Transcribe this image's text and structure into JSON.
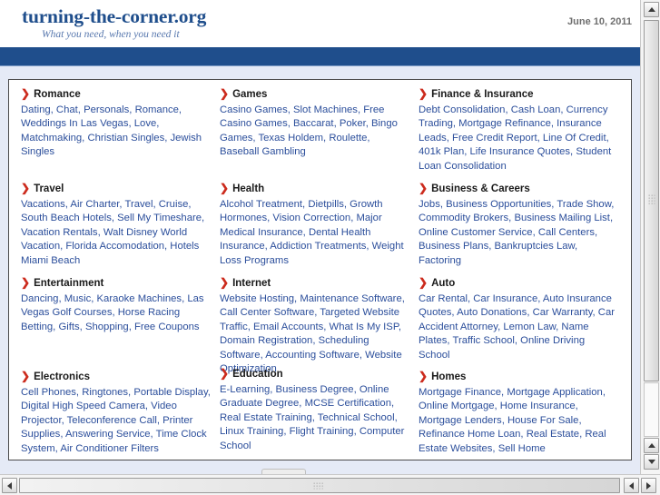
{
  "masthead": {
    "site_title": "turning-the-corner.org",
    "tagline": "What you need, when you need it",
    "date": "June 10, 2011"
  },
  "directory": {
    "arrow_glyph": "❯",
    "columns": [
      {
        "categories": [
          {
            "heading": "Romance",
            "links": "Dating, Chat, Personals, Romance, Weddings In Las Vegas, Love, Matchmaking, Christian Singles, Jewish Singles"
          },
          {
            "heading": "Travel",
            "links": "Vacations, Air Charter, Travel, Cruise, South Beach Hotels, Sell My Timeshare, Vacation Rentals, Walt Disney World Vacation, Florida Accomodation, Hotels Miami Beach"
          },
          {
            "heading": "Entertainment",
            "links": "Dancing, Music, Karaoke Machines, Las Vegas Golf Courses, Horse Racing Betting, Gifts, Shopping, Free Coupons"
          },
          {
            "heading": "Electronics",
            "links": "Cell Phones, Ringtones, Portable Display, Digital High Speed Camera, Video Projector, Teleconference Call, Printer Supplies, Answering Service, Time Clock System, Air Conditioner Filters"
          }
        ]
      },
      {
        "categories": [
          {
            "heading": "Games",
            "links": "Casino Games, Slot Machines, Free Casino Games, Baccarat, Poker, Bingo Games, Texas Holdem, Roulette, Baseball Gambling"
          },
          {
            "heading": "Health",
            "links": "Alcohol Treatment, Dietpills, Growth Hormones, Vision Correction, Major Medical Insurance, Dental Health Insurance, Addiction Treatments, Weight Loss Programs"
          },
          {
            "heading": "Internet",
            "links": "Website Hosting, Maintenance Software, Call Center Software, Targeted Website Traffic, Email Accounts, What Is My ISP, Domain Registration, Scheduling Software, Accounting Software, Website Optimization"
          },
          {
            "heading": "Education",
            "links": "E-Learning, Business Degree, Online Graduate Degree, MCSE Certification, Real Estate Training, Technical School, Linux Training, Flight Training, Computer School"
          }
        ]
      },
      {
        "categories": [
          {
            "heading": "Finance & Insurance",
            "links": "Debt Consolidation, Cash Loan, Currency Trading, Mortgage Refinance, Insurance Leads, Free Credit Report, Line Of Credit, 401k Plan, Life Insurance Quotes, Student Loan Consolidation"
          },
          {
            "heading": "Business & Careers",
            "links": "Jobs, Business Opportunities, Trade Show, Commodity Brokers, Business Mailing List, Online Customer Service, Call Centers, Business Plans, Bankruptcies Law, Factoring"
          },
          {
            "heading": "Auto",
            "links": "Car Rental, Car Insurance, Auto Insurance Quotes, Auto Donations, Car Warranty, Car Accident Attorney, Lemon Law, Name Plates, Traffic School, Online Driving School"
          },
          {
            "heading": "Homes",
            "links": "Mortgage Finance, Mortgage Application, Online Mortgage, Home Insurance, Mortgage Lenders, House For Sale, Refinance Home Loan, Real Estate, Real Estate Websites, Sell Home"
          }
        ]
      }
    ]
  },
  "colors": {
    "brand_blue": "#1F4E8C",
    "link_blue": "#2B4E9B",
    "arrow_red": "#CC2B1D",
    "page_background": "#E5EAF6",
    "tagline_blue": "#5878AE",
    "date_gray": "#6E6E6E"
  }
}
